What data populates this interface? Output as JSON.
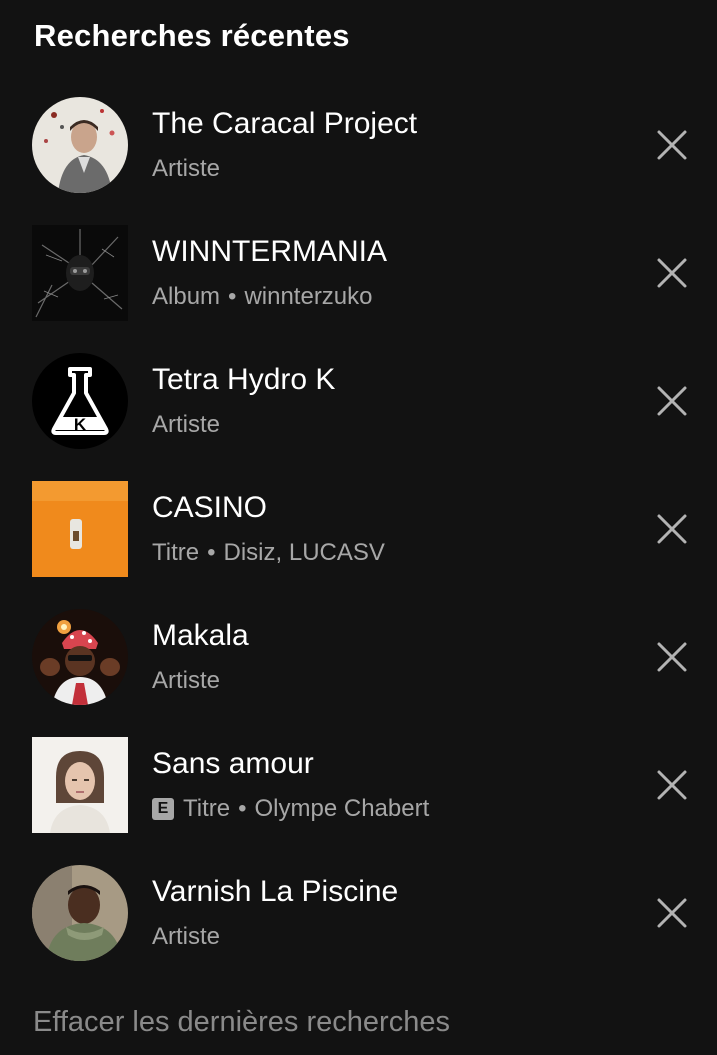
{
  "header": {
    "title": "Recherches récentes"
  },
  "items": [
    {
      "name": "The Caracal Project",
      "type": "Artiste",
      "detail": "",
      "explicit": false
    },
    {
      "name": "WINNTERMANIA",
      "type": "Album",
      "detail": "winnterzuko",
      "explicit": false
    },
    {
      "name": "Tetra Hydro K",
      "type": "Artiste",
      "detail": "",
      "explicit": false
    },
    {
      "name": "CASINO",
      "type": "Titre",
      "detail": "Disiz, LUCASV",
      "explicit": false
    },
    {
      "name": "Makala",
      "type": "Artiste",
      "detail": "",
      "explicit": false
    },
    {
      "name": "Sans amour",
      "type": "Titre",
      "detail": "Olympe Chabert",
      "explicit": true,
      "explicit_label": "E"
    },
    {
      "name": "Varnish La Piscine",
      "type": "Artiste",
      "detail": "",
      "explicit": false
    }
  ],
  "separator": "•",
  "clear_label": "Effacer les dernières recherches",
  "icons": {
    "remove": "close-icon"
  },
  "colors": {
    "background": "#121212",
    "primary_text": "#ffffff",
    "secondary_text": "#a7a7a7"
  }
}
